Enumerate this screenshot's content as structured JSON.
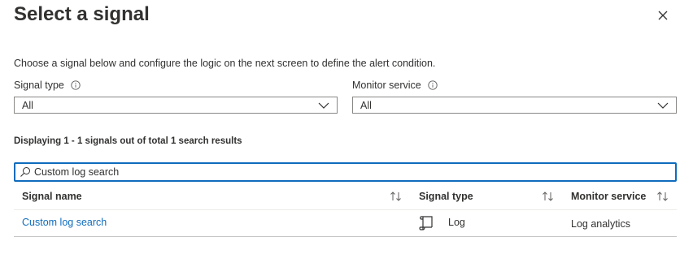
{
  "panel": {
    "title": "Select a signal",
    "description": "Choose a signal below and configure the logic on the next screen to define the alert condition."
  },
  "filters": {
    "signal_type": {
      "label": "Signal type",
      "value": "All"
    },
    "monitor_service": {
      "label": "Monitor service",
      "value": "All"
    }
  },
  "results_text": "Displaying 1 - 1 signals out of total 1 search results",
  "search": {
    "value": "Custom log search"
  },
  "table": {
    "columns": [
      "Signal name",
      "Signal type",
      "Monitor service"
    ],
    "rows": [
      {
        "signal_name": "Custom log search",
        "signal_type": "Log",
        "monitor_service": "Log analytics",
        "type_icon": "log-scroll-icon"
      }
    ]
  },
  "colors": {
    "accent": "#0f6cbd",
    "text": "#323130",
    "border": "#8a8886"
  }
}
